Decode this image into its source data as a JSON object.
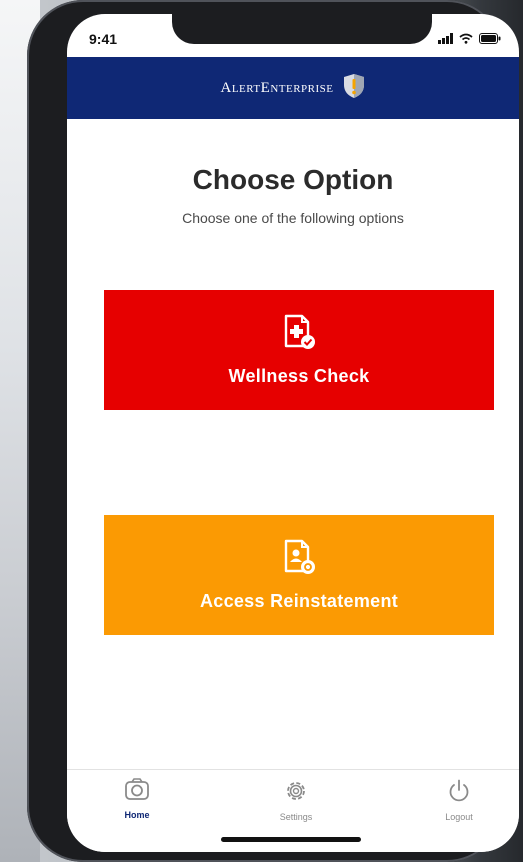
{
  "status_bar": {
    "time": "9:41",
    "icons": [
      "signal-icon",
      "wifi-icon",
      "battery-icon"
    ]
  },
  "header": {
    "brand": "AlertEnterprise",
    "logo_icon": "shield-icon",
    "color": "#0f2875"
  },
  "main": {
    "title": "Choose Option",
    "subtitle": "Choose one of the following options",
    "options": [
      {
        "label": "Wellness Check",
        "icon": "medical-checklist-icon",
        "color": "#e60000"
      },
      {
        "label": "Access Reinstatement",
        "icon": "document-badge-icon",
        "color": "#fb9a03"
      }
    ]
  },
  "bottom_nav": {
    "items": [
      {
        "label": "Home",
        "icon": "home-icon",
        "active": true
      },
      {
        "label": "Settings",
        "icon": "gear-icon",
        "active": false
      },
      {
        "label": "Logout",
        "icon": "power-icon",
        "active": false
      }
    ]
  }
}
